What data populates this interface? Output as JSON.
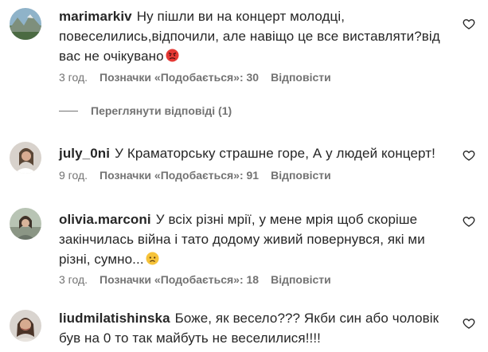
{
  "comments": [
    {
      "username": "marimarkiv",
      "text": "Ну пішли ви на концерт молодці, повеселились,відпочили, але навіщо це все виставляти?від вас не очікувано",
      "emoji": "angry-face",
      "time": "3 год.",
      "likes": "Позначки «Подобається»: 30",
      "reply": "Відповісти",
      "view_replies": "Переглянути відповіді (1)"
    },
    {
      "username": "july_0ni",
      "text": "У Краматорську страшне горе, А у людей концерт!",
      "time": "9 год.",
      "likes": "Позначки «Подобається»: 91",
      "reply": "Відповісти"
    },
    {
      "username": "olivia.marconi",
      "text": "У всіх різні мрії, у мене мрія щоб скоріше закінчилась війна і тато додому живий повернувся, які ми різні, сумно...",
      "emoji": "sad-face",
      "time": "3 год.",
      "likes": "Позначки «Подобається»: 18",
      "reply": "Відповісти"
    },
    {
      "username": "liudmilatishinska",
      "text": "Боже, як весело??? Якби син або чоловік був на 0 то так майбуть не веселилися!!!!"
    }
  ],
  "colors": {
    "text": "#262626",
    "secondary": "#737373",
    "background": "#ffffff"
  }
}
